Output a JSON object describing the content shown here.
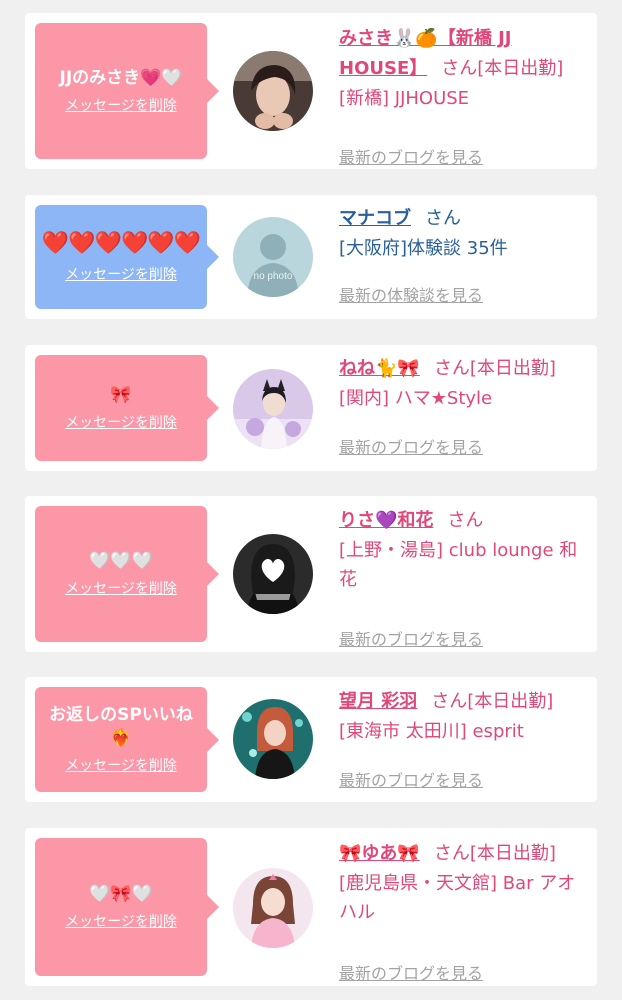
{
  "delete_label": "メッセージを削除",
  "colors": {
    "pink_bubble": "#fc97a8",
    "blue_bubble": "#8cb6f5",
    "pink_text": "#e0487a",
    "blue_text": "#2a5f9a",
    "gray_link": "#a3a3a3"
  },
  "cards": [
    {
      "message": "JJのみさき💗🤍",
      "name": "みさき🐰🍊【新橋 JJ HOUSE】",
      "honorific": "さん",
      "status": "[本日出勤]",
      "detail": "[新橋] JJHOUSE",
      "more": "最新のブログを見る"
    },
    {
      "message": "❤️❤️❤️❤️❤️❤️",
      "name": "マナコブ",
      "honorific": "さん",
      "status": "",
      "detail": "[大阪府]体験談 35件",
      "more": "最新の体験談を見る",
      "no_photo": "no photo"
    },
    {
      "message": "🎀",
      "name": "ねね🐈🎀",
      "honorific": "さん",
      "status": "[本日出勤]",
      "detail": "[関内] ハマ★Style",
      "more": "最新のブログを見る"
    },
    {
      "message": "🤍🤍🤍",
      "name": "りさ💜和花",
      "honorific": "さん",
      "status": "",
      "detail": "[上野・湯島] club lounge 和花",
      "more": "最新のブログを見る"
    },
    {
      "message": "お返しのSPいいね❤️‍🔥",
      "name": "望月 彩羽",
      "honorific": "さん",
      "status": "[本日出勤]",
      "detail": "[東海市 太田川] esprit",
      "more": "最新のブログを見る"
    },
    {
      "message": "🤍🎀🤍",
      "name": "🎀ゆあ🎀",
      "honorific": "さん",
      "status": "[本日出勤]",
      "detail": "[鹿児島県・天文館] Bar アオハル",
      "more": "最新のブログを見る"
    }
  ]
}
